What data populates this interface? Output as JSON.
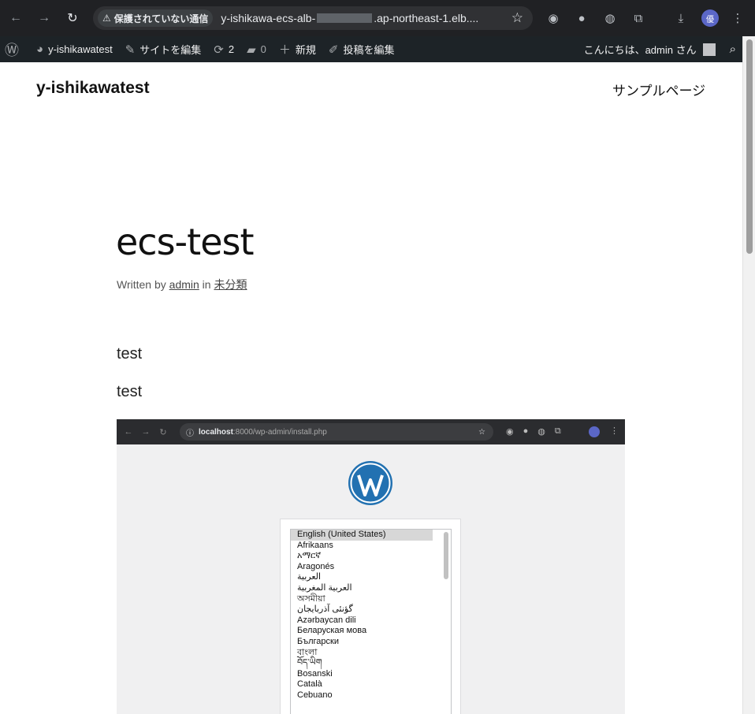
{
  "browser": {
    "security_label": "保護されていない通信",
    "url_prefix": "y-ishikawa-ecs-alb-",
    "url_suffix": ".ap-northeast-1.elb....",
    "profile_initial": "優"
  },
  "admin_bar": {
    "site_name": "y-ishikawatest",
    "edit_site": "サイトを編集",
    "updates_count": "2",
    "comments_count": "0",
    "new_label": "新規",
    "edit_post": "投稿を編集",
    "greeting": "こんにちは、admin さん"
  },
  "site": {
    "title": "y-ishikawatest",
    "nav_sample_page": "サンプルページ"
  },
  "post": {
    "title": "ecs-test",
    "meta_written_by": "Written by ",
    "meta_author": "admin",
    "meta_in": " in ",
    "meta_category": "未分類",
    "paragraphs": [
      "test",
      "test"
    ]
  },
  "embed": {
    "url_host": "localhost",
    "url_path": ":8000/wp-admin/install.php",
    "languages": [
      "English (United States)",
      "Afrikaans",
      "አማርኛ",
      "Aragonés",
      "العربية",
      "العربية المغربية",
      "অসমীয়া",
      "گؤنئی آذربایجان",
      "Azərbaycan dili",
      "Беларуская мова",
      "Български",
      "বাংলা",
      "བོད་ཡིག",
      "Bosanski",
      "Català",
      "Cebuano"
    ]
  }
}
